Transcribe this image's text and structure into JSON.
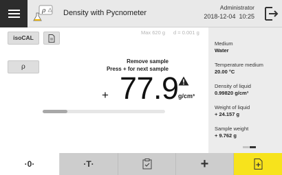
{
  "header": {
    "title": "Density with Pycnometer",
    "user": "Administrator",
    "date": "2018-12-04",
    "time": "10:25",
    "app_icon_label": "ρ"
  },
  "tools": {
    "isocal_label": "isoCAL",
    "rho_label": "ρ"
  },
  "balance": {
    "max_capacity": "Max 620 g",
    "readability": "d = 0.001 g",
    "instruction_line1": "Remove sample",
    "instruction_line2": "Press + for next sample",
    "sign": "+",
    "value": "77.9",
    "unit": "g/cm³",
    "progress": 0.2
  },
  "results": {
    "items": [
      {
        "label": "Medium",
        "value": "Water"
      },
      {
        "label": "Temperature medium",
        "value": "20.00 °C"
      },
      {
        "label": "Density of liquid",
        "value": "0.99820 g/cm³"
      },
      {
        "label": "Weight of liquid",
        "value": "+ 24.157 g"
      },
      {
        "label": "Sample weight",
        "value": "+ 9.762 g"
      }
    ]
  },
  "bottom_bar": {
    "zero_label": "·0·",
    "tare_label": "·T·",
    "plus_label": "+"
  },
  "colors": {
    "accent": "#f7e31c",
    "header_bg": "#e9e9e9",
    "menu_bg": "#2c2c2c",
    "bottom_bg": "#cdcdcd"
  },
  "icons": [
    "menu-icon",
    "pycnometer-icon",
    "logout-icon",
    "document-icon",
    "warning-icon",
    "checklist-icon",
    "result-export-icon"
  ]
}
